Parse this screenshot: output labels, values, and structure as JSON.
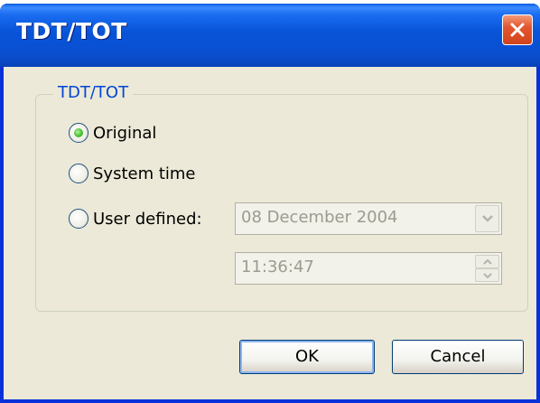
{
  "window": {
    "title": "TDT/TOT"
  },
  "group": {
    "title": "TDT/TOT"
  },
  "options": [
    {
      "label": "Original",
      "checked": true
    },
    {
      "label": "System time",
      "checked": false
    },
    {
      "label": "User defined:",
      "checked": false
    }
  ],
  "user_defined": {
    "date": "08 December 2004",
    "time": "11:36:47"
  },
  "buttons": {
    "ok": "OK",
    "cancel": "Cancel"
  },
  "colors": {
    "titlebar": "#0853d8",
    "client": "#ece9d8",
    "group_title": "#0046d5",
    "close_button": "#e3572e",
    "radio_checked": "#21a31f",
    "disabled_text": "#9b9b8f"
  },
  "icons": {
    "close": "close-icon",
    "dropdown": "chevron-down-icon",
    "spin_up": "chevron-up-icon",
    "spin_down": "chevron-down-icon"
  }
}
